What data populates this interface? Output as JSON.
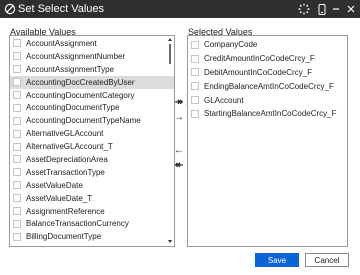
{
  "window": {
    "title": "Set Select Values"
  },
  "available": {
    "label": "Available Values",
    "items": [
      "AccountAssignment",
      "AccountAssignmentNumber",
      "AccountAssignmentType",
      "AccountingDocCreatedByUser",
      "AccountingDocumentCategory",
      "AccountingDocumentType",
      "AccountingDocumentTypeName",
      "AlternativeGLAccount",
      "AlternativeGLAccount_T",
      "AssetDepreciationArea",
      "AssetTransactionType",
      "AssetValueDate",
      "AssetValueDate_T",
      "AssignmentReference",
      "BalanceTransactionCurrency",
      "BillingDocumentType"
    ],
    "highlighted_item": "AccountingDocCreatedByUser"
  },
  "selected": {
    "label": "Selected Values",
    "items": [
      "CompanyCode",
      "CreditAmountInCoCodeCrcy_F",
      "DebitAmountInCoCodeCrcy_F",
      "EndingBalanceAmtInCoCodeCrcy_F",
      "GLAccount",
      "StartingBalanceAmtInCoCodeCrcy_F"
    ]
  },
  "move_buttons": {
    "add_all": "↠",
    "add": "→",
    "remove": "←",
    "remove_all": "↞"
  },
  "footer": {
    "save": "Save",
    "cancel": "Cancel"
  },
  "colors": {
    "titlebar": "#2f2f2f",
    "accent": "#0b63d8",
    "highlight": "#dcdcdc"
  }
}
